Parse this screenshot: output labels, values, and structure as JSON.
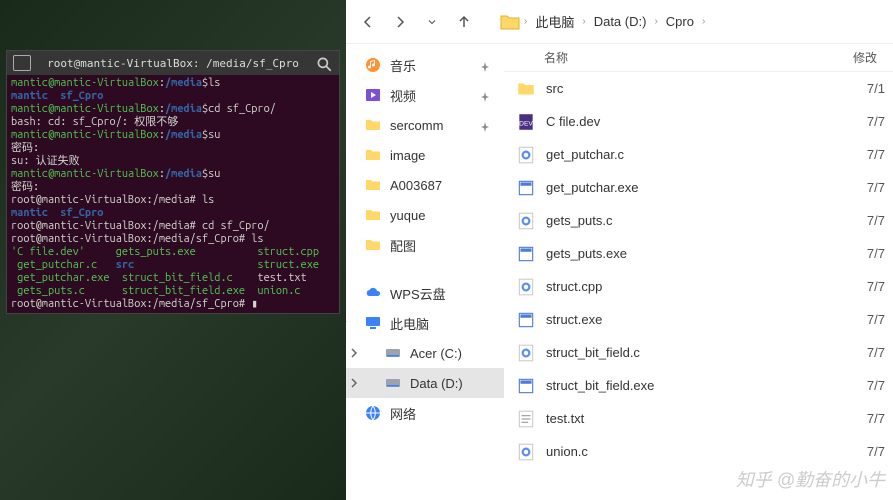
{
  "terminal": {
    "title": "root@mantic-VirtualBox: /media/sf_Cpro",
    "lines": [
      {
        "parts": [
          {
            "c": "t-green",
            "t": "mantic@mantic-VirtualBox"
          },
          {
            "c": "t-white",
            "t": ":"
          },
          {
            "c": "t-blue",
            "t": "/media"
          },
          {
            "c": "t-white",
            "t": "$ls"
          }
        ]
      },
      {
        "parts": [
          {
            "c": "t-blue",
            "t": "mantic  sf_Cpro"
          }
        ]
      },
      {
        "parts": [
          {
            "c": "t-green",
            "t": "mantic@mantic-VirtualBox"
          },
          {
            "c": "t-white",
            "t": ":"
          },
          {
            "c": "t-blue",
            "t": "/media"
          },
          {
            "c": "t-white",
            "t": "$cd sf_Cpro/"
          }
        ]
      },
      {
        "parts": [
          {
            "c": "t-white",
            "t": "bash: cd: sf_Cpro/: 权限不够"
          }
        ]
      },
      {
        "parts": [
          {
            "c": "t-green",
            "t": "mantic@mantic-VirtualBox"
          },
          {
            "c": "t-white",
            "t": ":"
          },
          {
            "c": "t-blue",
            "t": "/media"
          },
          {
            "c": "t-white",
            "t": "$su"
          }
        ]
      },
      {
        "parts": [
          {
            "c": "t-white",
            "t": "密码:"
          }
        ]
      },
      {
        "parts": [
          {
            "c": "t-white",
            "t": "su: 认证失败"
          }
        ]
      },
      {
        "parts": [
          {
            "c": "t-green",
            "t": "mantic@mantic-VirtualBox"
          },
          {
            "c": "t-white",
            "t": ":"
          },
          {
            "c": "t-blue",
            "t": "/media"
          },
          {
            "c": "t-white",
            "t": "$su"
          }
        ]
      },
      {
        "parts": [
          {
            "c": "t-white",
            "t": "密码:"
          }
        ]
      },
      {
        "parts": [
          {
            "c": "t-white",
            "t": "root@mantic-VirtualBox:/media# ls"
          }
        ]
      },
      {
        "parts": [
          {
            "c": "t-blue",
            "t": "mantic  sf_Cpro"
          }
        ]
      },
      {
        "parts": [
          {
            "c": "t-white",
            "t": "root@mantic-VirtualBox:/media# cd sf_Cpro/"
          }
        ]
      },
      {
        "parts": [
          {
            "c": "t-white",
            "t": "root@mantic-VirtualBox:/media/sf_Cpro# ls"
          }
        ]
      },
      {
        "parts": [
          {
            "c": "t-green",
            "t": "'C file.dev'     gets_puts.exe          struct.cpp"
          }
        ]
      },
      {
        "parts": [
          {
            "c": "t-green",
            "t": " get_putchar.c   "
          },
          {
            "c": "t-blue",
            "t": "src"
          },
          {
            "c": "t-green",
            "t": "                    struct.exe"
          }
        ]
      },
      {
        "parts": [
          {
            "c": "t-green",
            "t": " get_putchar.exe  struct_bit_field.c    "
          },
          {
            "c": "t-white",
            "t": "test.txt"
          }
        ]
      },
      {
        "parts": [
          {
            "c": "t-green",
            "t": " gets_puts.c      struct_bit_field.exe  union.c"
          }
        ]
      },
      {
        "parts": [
          {
            "c": "t-white",
            "t": "root@mantic-VirtualBox:/media/sf_Cpro# "
          },
          {
            "c": "t-white",
            "t": "▮"
          }
        ]
      }
    ]
  },
  "explorer": {
    "breadcrumb": [
      "此电脑",
      "Data (D:)",
      "Cpro"
    ],
    "sidebar": [
      {
        "icon": "music",
        "label": "音乐",
        "pin": true
      },
      {
        "icon": "video",
        "label": "视频",
        "pin": true
      },
      {
        "icon": "folder",
        "label": "sercomm",
        "pin": true
      },
      {
        "icon": "folder",
        "label": "image"
      },
      {
        "icon": "folder",
        "label": "A003687"
      },
      {
        "icon": "folder",
        "label": "yuque"
      },
      {
        "icon": "folder",
        "label": "配图"
      },
      {
        "spacer": true
      },
      {
        "icon": "cloud",
        "label": "WPS云盘"
      },
      {
        "icon": "computer",
        "label": "此电脑",
        "chev": "open"
      },
      {
        "icon": "disk",
        "label": "Acer (C:)",
        "indent": 2,
        "chev": "closed"
      },
      {
        "icon": "disk",
        "label": "Data (D:)",
        "indent": 2,
        "chev": "closed",
        "selected": true
      },
      {
        "icon": "network",
        "label": "网络",
        "chev": "closed"
      }
    ],
    "cols": {
      "name": "名称",
      "date": "修改"
    },
    "files": [
      {
        "icon": "folder",
        "name": "src",
        "date": "7/1"
      },
      {
        "icon": "dev",
        "name": "C file.dev",
        "date": "7/7"
      },
      {
        "icon": "c",
        "name": "get_putchar.c",
        "date": "7/7"
      },
      {
        "icon": "exe",
        "name": "get_putchar.exe",
        "date": "7/7"
      },
      {
        "icon": "c",
        "name": "gets_puts.c",
        "date": "7/7"
      },
      {
        "icon": "exe",
        "name": "gets_puts.exe",
        "date": "7/7"
      },
      {
        "icon": "c",
        "name": "struct.cpp",
        "date": "7/7"
      },
      {
        "icon": "exe",
        "name": "struct.exe",
        "date": "7/7"
      },
      {
        "icon": "c",
        "name": "struct_bit_field.c",
        "date": "7/7"
      },
      {
        "icon": "exe",
        "name": "struct_bit_field.exe",
        "date": "7/7"
      },
      {
        "icon": "txt",
        "name": "test.txt",
        "date": "7/7"
      },
      {
        "icon": "c",
        "name": "union.c",
        "date": "7/7"
      }
    ]
  },
  "watermark": "知乎 @勤奋的小牛"
}
